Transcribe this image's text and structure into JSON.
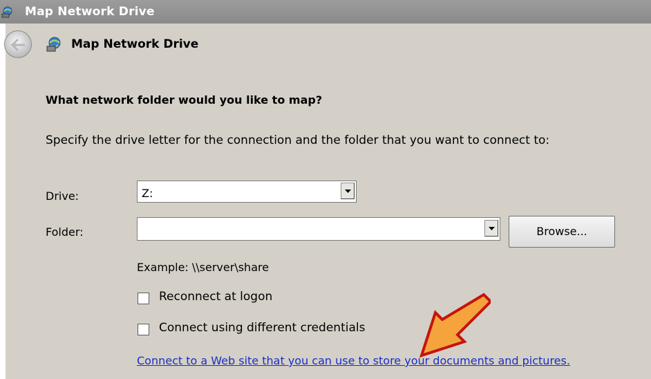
{
  "window": {
    "title": "Map Network Drive"
  },
  "header": {
    "title": "Map Network Drive"
  },
  "question": "What network folder would you like to map?",
  "instructions": "Specify the drive letter for the connection and the folder that you want to connect to:",
  "drive": {
    "label": "Drive:",
    "value": "Z:"
  },
  "folder": {
    "label": "Folder:",
    "value": "",
    "browse_label": "Browse..."
  },
  "example": "Example: \\\\server\\share",
  "options": {
    "reconnect": {
      "label": "Reconnect at logon",
      "checked": false
    },
    "credentials": {
      "label": "Connect using different credentials",
      "checked": false
    }
  },
  "link_text": "Connect to a Web site that you can use to store your documents and pictures.",
  "annotation": {
    "arrow_color": "#f5a33c",
    "arrow_outline": "#c4140c"
  },
  "icons": {
    "window": "network-drive-icon",
    "header": "network-drive-icon",
    "back": "back-arrow-icon"
  }
}
